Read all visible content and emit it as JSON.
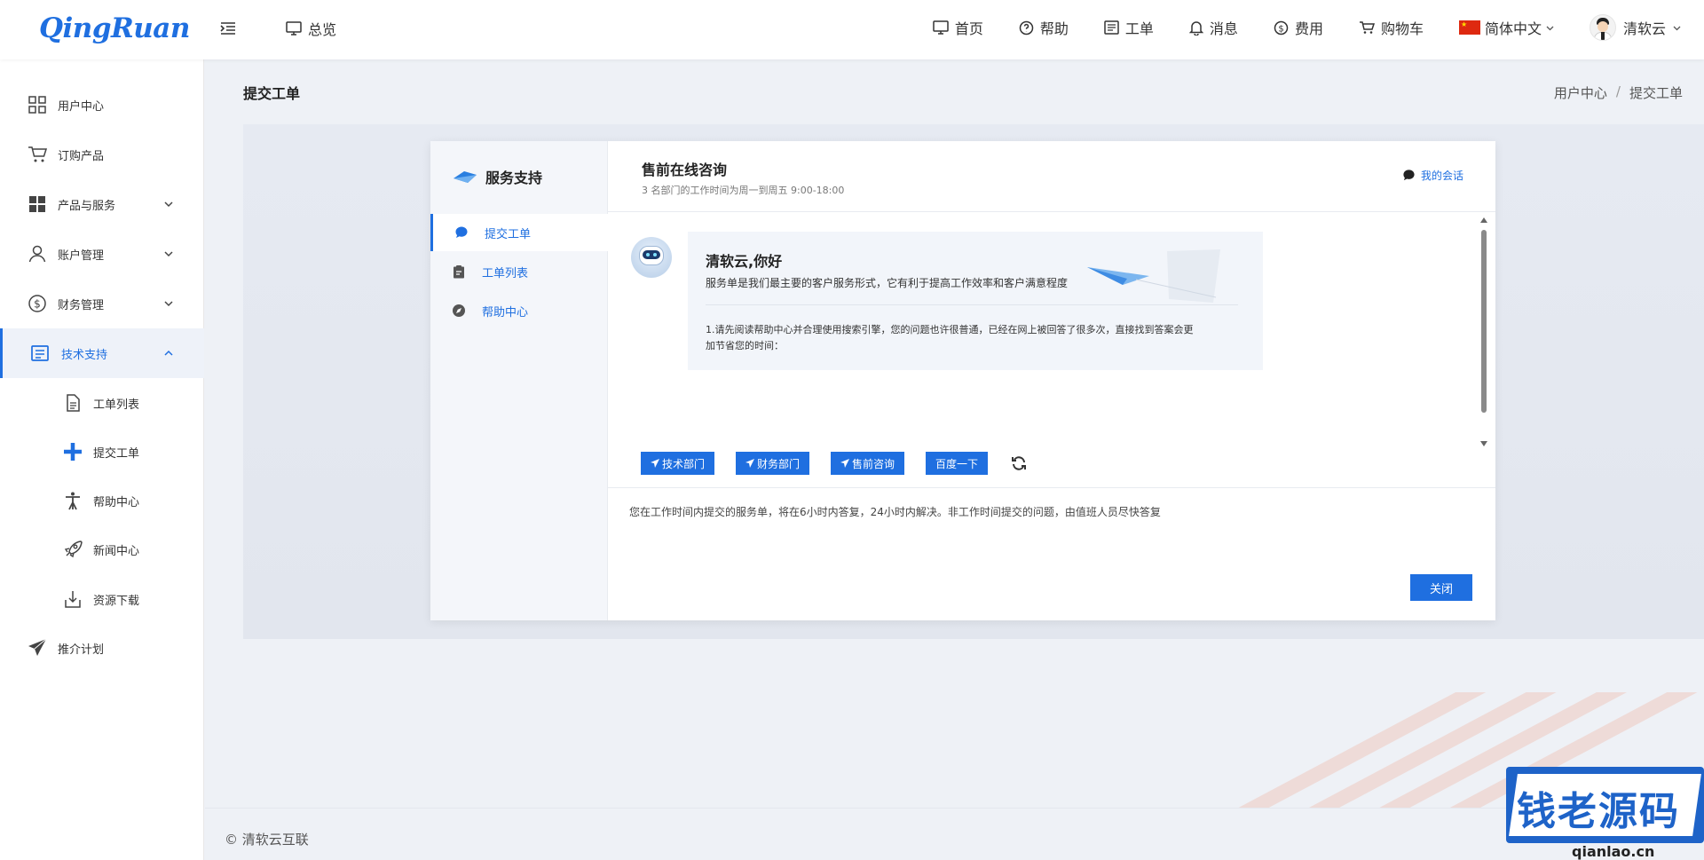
{
  "header": {
    "logo": "QingRuan",
    "overview_label": "总览",
    "nav": [
      {
        "label": "首页",
        "icon": "monitor-icon"
      },
      {
        "label": "帮助",
        "icon": "question-icon"
      },
      {
        "label": "工单",
        "icon": "ticket-icon"
      },
      {
        "label": "消息",
        "icon": "bell-icon"
      },
      {
        "label": "费用",
        "icon": "dollar-icon"
      },
      {
        "label": "购物车",
        "icon": "cart-icon"
      }
    ],
    "language": "简体中文",
    "user": "清软云"
  },
  "sidebar": {
    "items": [
      {
        "label": "用户中心",
        "icon": "grid-icon"
      },
      {
        "label": "订购产品",
        "icon": "cart-icon"
      },
      {
        "label": "产品与服务",
        "icon": "apps-icon"
      },
      {
        "label": "账户管理",
        "icon": "user-icon"
      },
      {
        "label": "财务管理",
        "icon": "dollar-icon"
      },
      {
        "label": "技术支持",
        "icon": "support-icon"
      },
      {
        "label": "工单列表",
        "icon": "document-icon"
      },
      {
        "label": "提交工单",
        "icon": "plus-icon"
      },
      {
        "label": "帮助中心",
        "icon": "person-icon"
      },
      {
        "label": "新闻中心",
        "icon": "rocket-icon"
      },
      {
        "label": "资源下载",
        "icon": "download-icon"
      },
      {
        "label": "推介计划",
        "icon": "paper-plane-icon"
      }
    ]
  },
  "page": {
    "title": "提交工单",
    "breadcrumb": [
      "用户中心",
      "/",
      "提交工单"
    ]
  },
  "card": {
    "support_title": "服务支持",
    "left_menu": [
      "提交工单",
      "工单列表",
      "帮助中心"
    ],
    "header_title": "售前在线咨询",
    "header_subtitle": "3 名部门的工作时间为周一到周五 9:00-18:00",
    "my_chat": "我的会话",
    "bubble": {
      "title": "清软云,你好",
      "line1": "服务单是我们最主要的客户服务形式，它有利于提高工作效率和客户满意程度",
      "line2": "1.请先阅读帮助中心并合理使用搜索引擎，您的问题也许很普通，已经在网上被回答了很多次，直接找到答案会更加节省您的时间："
    },
    "departments": [
      "技术部门",
      "财务部门",
      "售前咨询",
      "百度一下"
    ],
    "reply_note": "您在工作时间内提交的服务单，将在6小时内答复，24小时内解决。非工作时间提交的问题，由值班人员尽快答复",
    "close_label": "关闭"
  },
  "footer": {
    "copyright": "© 清软云互联"
  },
  "watermark": {
    "title": "钱老源码",
    "site": "qianlao.cn"
  },
  "colors": {
    "accent": "#1f6fe0",
    "sidebar_active_bg": "#eef2f9"
  }
}
